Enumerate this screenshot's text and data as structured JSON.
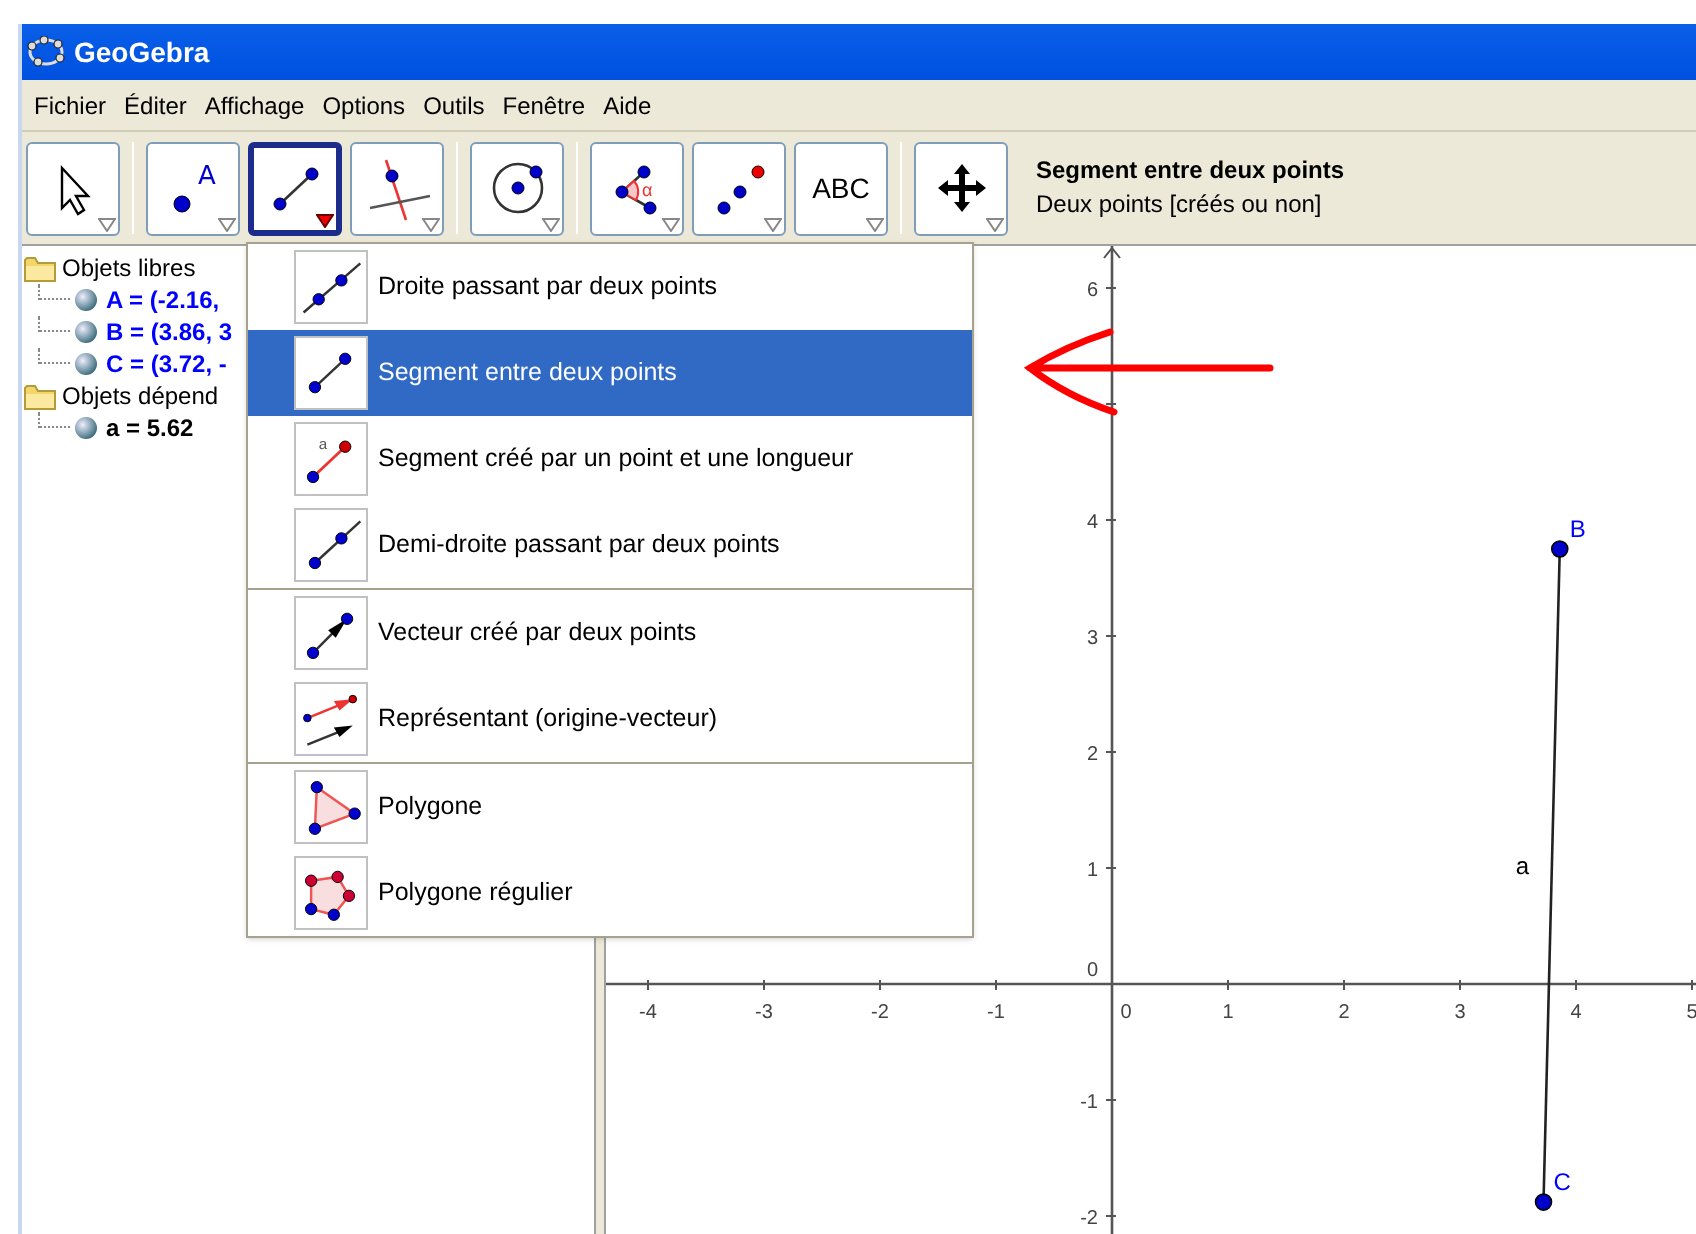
{
  "window": {
    "title": "GeoGebra"
  },
  "menu_bar": [
    "Fichier",
    "Éditer",
    "Affichage",
    "Options",
    "Outils",
    "Fenêtre",
    "Aide"
  ],
  "toolbar": {
    "groups": [
      [
        {
          "kind": "pointer",
          "selected": false
        }
      ],
      [
        {
          "kind": "point",
          "label": "A",
          "selected": false
        },
        {
          "kind": "segment",
          "selected": true
        },
        {
          "kind": "perpendicular",
          "selected": false
        }
      ],
      [
        {
          "kind": "circle",
          "selected": false
        }
      ],
      [
        {
          "kind": "angle",
          "label": "α",
          "selected": false
        },
        {
          "kind": "points",
          "selected": false
        },
        {
          "kind": "text",
          "label": "ABC",
          "selected": false
        }
      ],
      [
        {
          "kind": "move-view",
          "selected": false
        }
      ]
    ],
    "help": {
      "title": "Segment entre deux points",
      "hint": "Deux points [créés ou non]"
    }
  },
  "algebra": {
    "folders": [
      {
        "name": "Objets libres",
        "children": [
          {
            "text": "A = (-2.16,",
            "color": "#0000ff"
          },
          {
            "text": "B = (3.86, 3",
            "color": "#0000ff"
          },
          {
            "text": "C = (3.72, -",
            "color": "#0000ff"
          }
        ]
      },
      {
        "name": "Objets dépend",
        "children": [
          {
            "text": "a = 5.62",
            "color": "#000000"
          }
        ]
      }
    ]
  },
  "tool_menu": {
    "groups": [
      [
        {
          "kind": "line",
          "label": "Droite passant par deux points",
          "selected": false
        },
        {
          "kind": "segment",
          "label": "Segment entre deux points",
          "selected": true
        },
        {
          "kind": "segment-length",
          "icon_label": "a",
          "label": "Segment créé par un point et une longueur",
          "selected": false
        },
        {
          "kind": "ray",
          "label": "Demi-droite passant par deux points",
          "selected": false
        }
      ],
      [
        {
          "kind": "vector",
          "label": "Vecteur créé par deux points",
          "selected": false
        },
        {
          "kind": "vector-from-point",
          "label": "Représentant (origine-vecteur)",
          "selected": false
        }
      ],
      [
        {
          "kind": "polygon",
          "label": "Polygone",
          "selected": false
        },
        {
          "kind": "regular-polygon",
          "label": "Polygone régulier",
          "selected": false
        }
      ]
    ]
  },
  "graphics": {
    "x_ticks": [
      "-4",
      "-3",
      "-2",
      "-1",
      "0",
      "1",
      "2",
      "3",
      "4",
      "5"
    ],
    "y_ticks": [
      "6",
      "4",
      "3",
      "2",
      "1",
      "0",
      "-1",
      "-2"
    ],
    "points": [
      {
        "label": "B"
      },
      {
        "label": "C"
      }
    ],
    "segment_label": "a"
  }
}
